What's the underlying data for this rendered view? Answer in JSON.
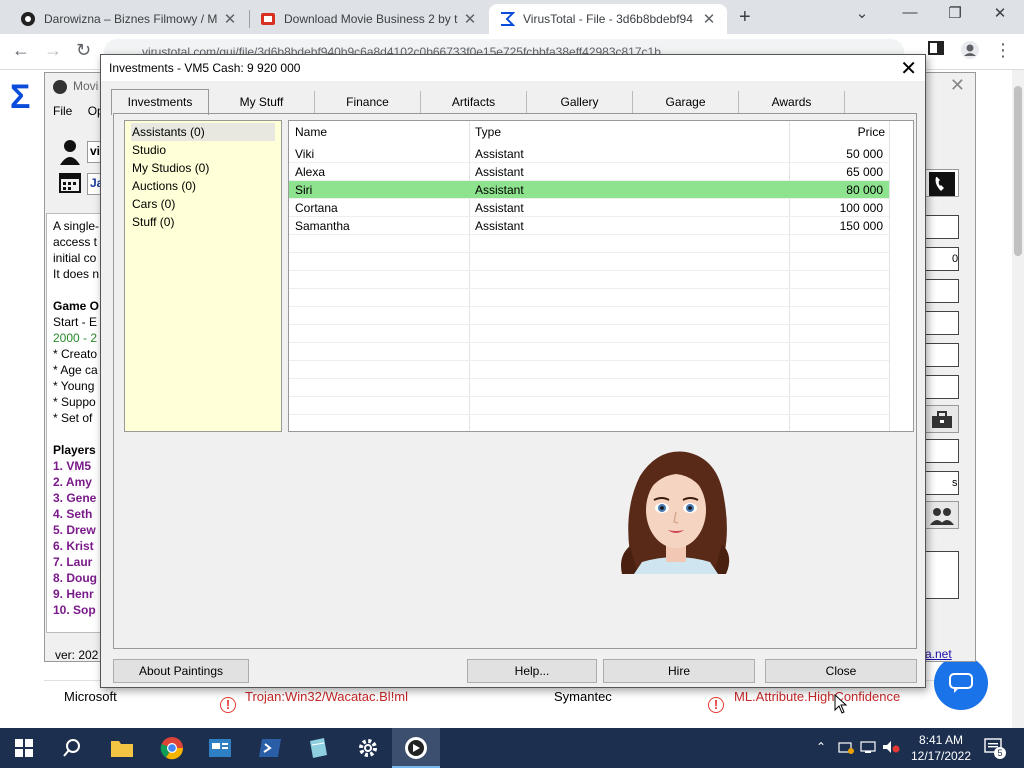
{
  "browser": {
    "tabs": [
      {
        "title": "Darowizna – Biznes Filmowy / M",
        "icon": "site-icon"
      },
      {
        "title": "Download Movie Business 2 by t",
        "icon": "download-site-icon"
      },
      {
        "title": "VirusTotal - File - 3d6b8bdebf94",
        "icon": "virustotal-icon",
        "active": true
      }
    ],
    "url": "virustotal.com/gui/file/3d6b8bdebf940b9c6a8d4102c0b66733f0e15e725fcbbfa38eff42983c817c1b",
    "new_tab": "+",
    "controls": {
      "minimize": "—",
      "restore": "❐",
      "close": "✕",
      "chevron": "⌄"
    }
  },
  "vt_page": {
    "detections": [
      {
        "vendor": "Microsoft",
        "result": "Trojan:Win32/Wacatac.Bl!ml"
      },
      {
        "vendor": "Symantec",
        "result": "ML.Attribute.HighConfidence"
      }
    ]
  },
  "background_app": {
    "title": "Movi",
    "menu": [
      "File",
      "Op"
    ],
    "player_field": "vi",
    "date_field": "Ja",
    "text_lines": [
      {
        "text": "A single-",
        "style": ""
      },
      {
        "text": " access t",
        "style": ""
      },
      {
        "text": " initial co",
        "style": ""
      },
      {
        "text": "It does n",
        "style": ""
      },
      {
        "text": "",
        "style": ""
      },
      {
        "text": "Game O",
        "style": "b"
      },
      {
        "text": "Start - E",
        "style": ""
      },
      {
        "text": "2000 - 2",
        "style": "g"
      },
      {
        "text": "* Creato",
        "style": ""
      },
      {
        "text": "* Age ca",
        "style": ""
      },
      {
        "text": "* Young",
        "style": ""
      },
      {
        "text": "* Suppo",
        "style": ""
      },
      {
        "text": "* Set of",
        "style": ""
      },
      {
        "text": "",
        "style": ""
      },
      {
        "text": "Players",
        "style": "b"
      },
      {
        "text": "1. VM5",
        "style": "p"
      },
      {
        "text": "2. Amy",
        "style": "p"
      },
      {
        "text": "3. Gene",
        "style": "p"
      },
      {
        "text": "4. Seth",
        "style": "p"
      },
      {
        "text": "5. Drew",
        "style": "p"
      },
      {
        "text": "6. Krist",
        "style": "p"
      },
      {
        "text": "7. Laur",
        "style": "p"
      },
      {
        "text": "8. Doug",
        "style": "p"
      },
      {
        "text": "9. Henr",
        "style": "p"
      },
      {
        "text": "10. Sop",
        "style": "p"
      }
    ],
    "version": "ver: 202",
    "side_partial_text": {
      "a": "0",
      "b": "s"
    },
    "link_text": "a.net"
  },
  "dialog": {
    "title": "Investments - VM5 Cash: 9 920 000",
    "close": "✕",
    "tabs": [
      "Investments",
      "My Stuff",
      "Finance",
      "Artifacts",
      "Gallery",
      "Garage",
      "Awards"
    ],
    "selected_tab": "Investments",
    "categories": [
      "Assistants (0)",
      "Studio",
      "My Studios (0)",
      "Auctions (0)",
      "Cars (0)",
      "Stuff (0)"
    ],
    "selected_category": "Assistants (0)",
    "table": {
      "columns": [
        "Name",
        "Type",
        "Price"
      ],
      "rows": [
        {
          "name": "Viki",
          "type": "Assistant",
          "price": "50 000"
        },
        {
          "name": "Alexa",
          "type": "Assistant",
          "price": "65 000"
        },
        {
          "name": "Siri",
          "type": "Assistant",
          "price": "80 000",
          "selected": true
        },
        {
          "name": "Cortana",
          "type": "Assistant",
          "price": "100 000"
        },
        {
          "name": "Samantha",
          "type": "Assistant",
          "price": "150 000"
        }
      ]
    },
    "buttons": {
      "about_paintings": "About Paintings",
      "help": "Help...",
      "hire": "Hire",
      "close": "Close"
    },
    "selection_color": "#8ee38e"
  },
  "taskbar": {
    "time": "8:41 AM",
    "date": "12/17/2022",
    "notifications": "5",
    "apps": [
      "start-icon",
      "search-icon",
      "file-explorer-icon",
      "chrome-icon",
      "app-icon",
      "powershell-icon",
      "notepad-icon",
      "settings-icon",
      "movie-business-icon"
    ]
  }
}
